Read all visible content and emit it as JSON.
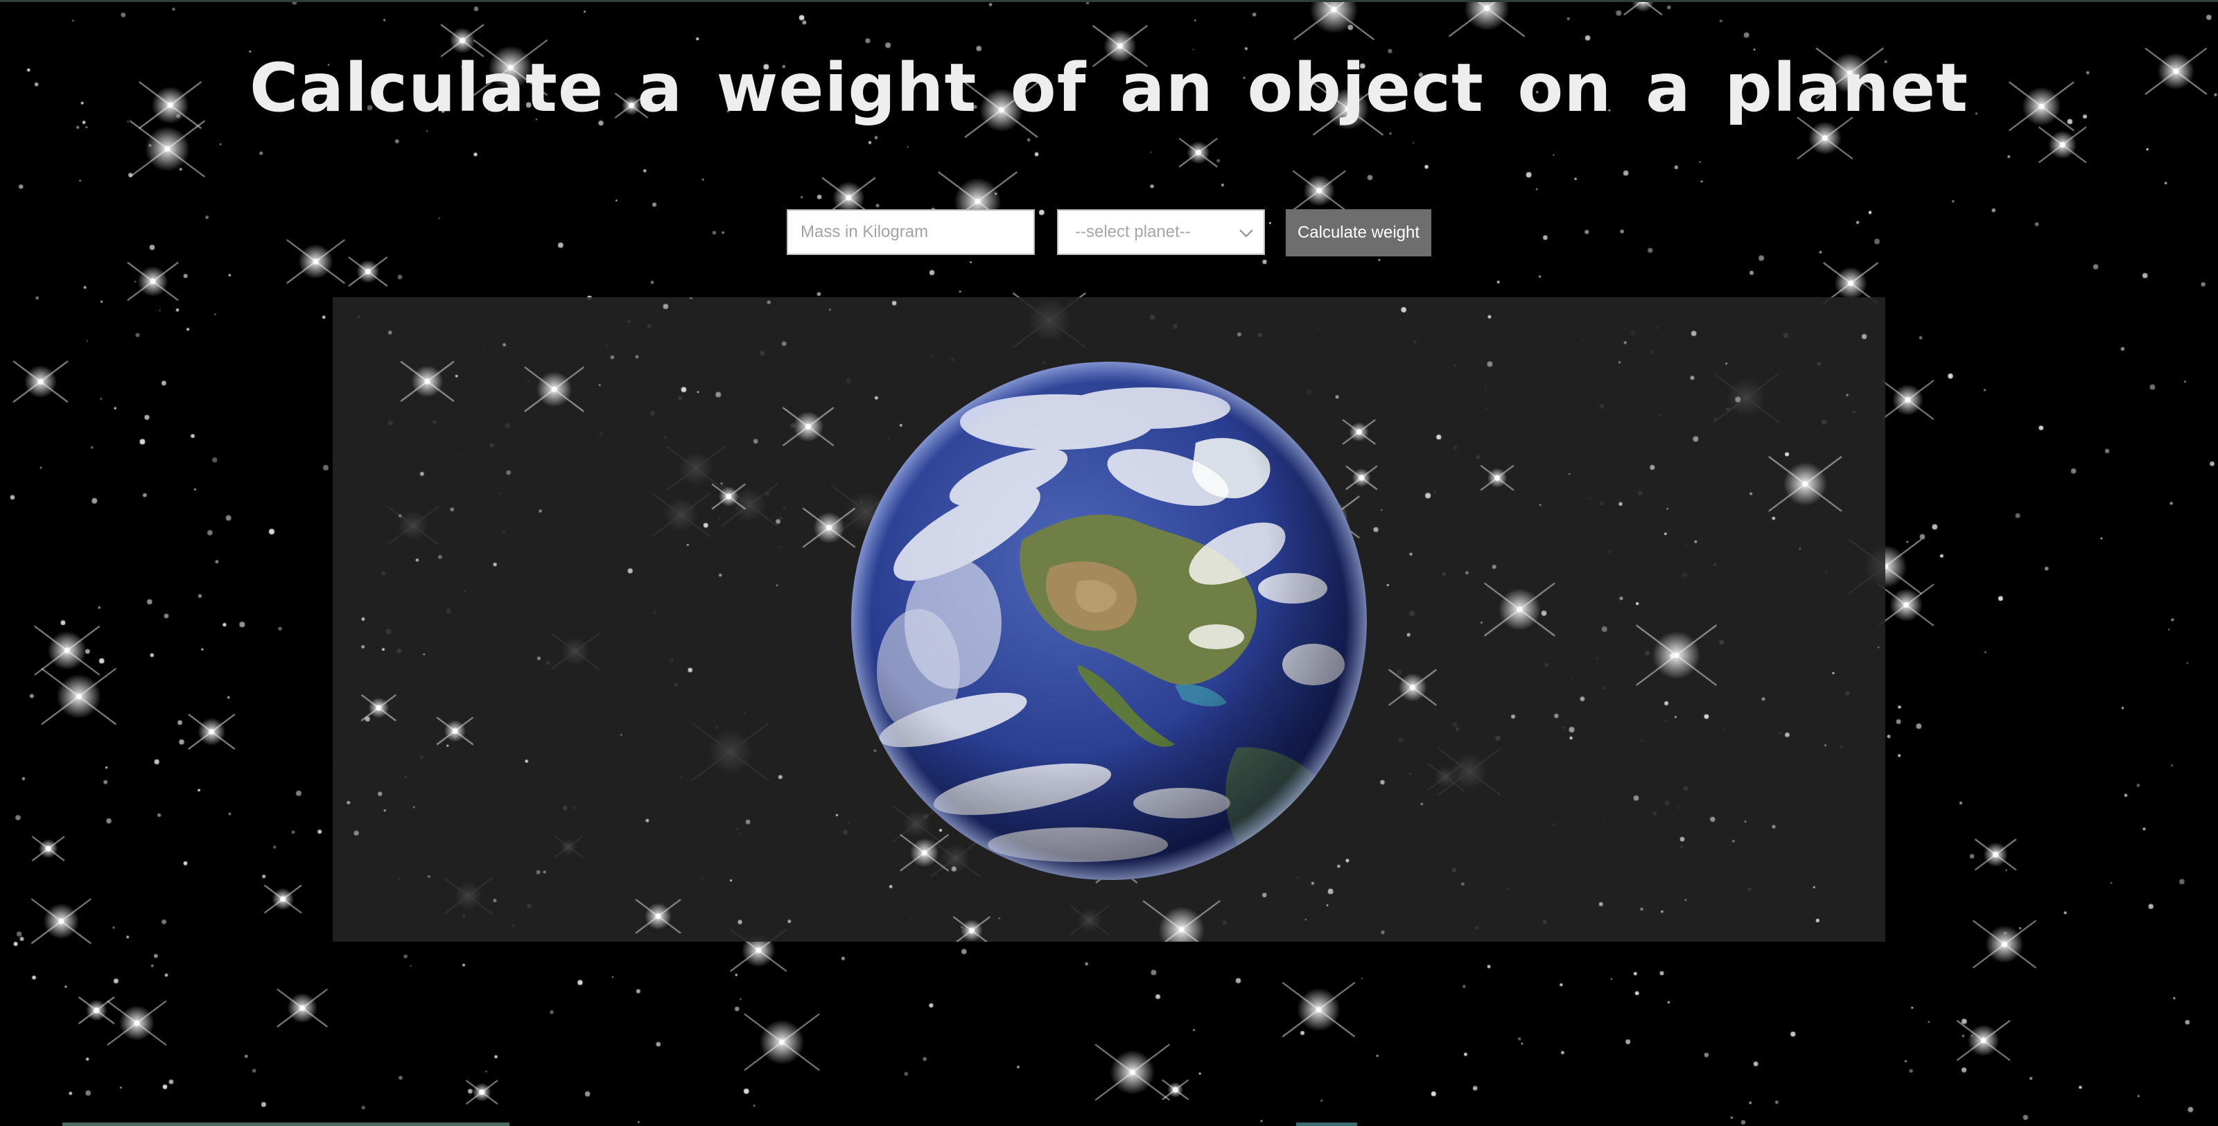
{
  "title": "Calculate a weight of an object on a planet",
  "form": {
    "mass_placeholder": "Mass in Kilogram",
    "mass_value": "",
    "planet_select_value": "--select planet--",
    "submit_label": "Calculate weight"
  },
  "planet_image": {
    "icon": "earth-globe-icon"
  },
  "colors": {
    "background": "#000000",
    "title": "#eeeeee",
    "button_bg": "#6e6e6e",
    "button_text": "#ffffff",
    "panel_bg": "#242424",
    "placeholder": "#a3a3a3"
  }
}
